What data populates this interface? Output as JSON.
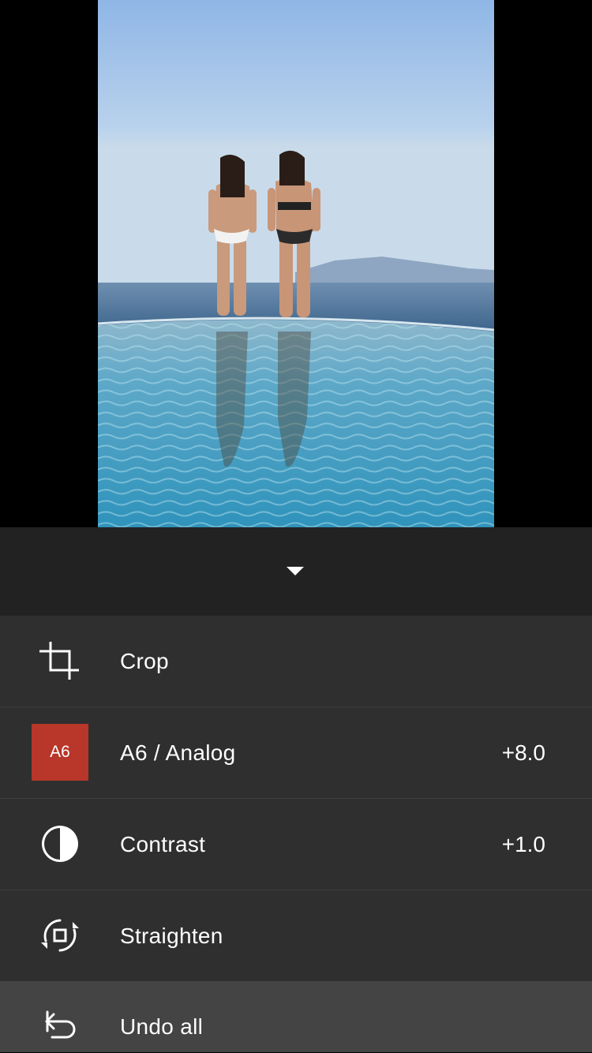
{
  "photo": {
    "description_icon": "photo-preview"
  },
  "collapse": {
    "icon": "chevron-down-icon"
  },
  "menu": {
    "items": [
      {
        "icon": "crop-icon",
        "label": "Crop",
        "value": ""
      },
      {
        "icon": "preset-badge",
        "badge": "A6",
        "badge_color": "#b8362a",
        "label": "A6 / Analog",
        "value": "+8.0"
      },
      {
        "icon": "contrast-icon",
        "label": "Contrast",
        "value": "+1.0"
      },
      {
        "icon": "straighten-icon",
        "label": "Straighten",
        "value": ""
      },
      {
        "icon": "undo-icon",
        "label": "Undo all",
        "value": ""
      }
    ]
  },
  "colors": {
    "panel": "#2f2f2f",
    "collapse_bar": "#222222",
    "undo_row": "#444444",
    "accent": "#b8362a"
  }
}
